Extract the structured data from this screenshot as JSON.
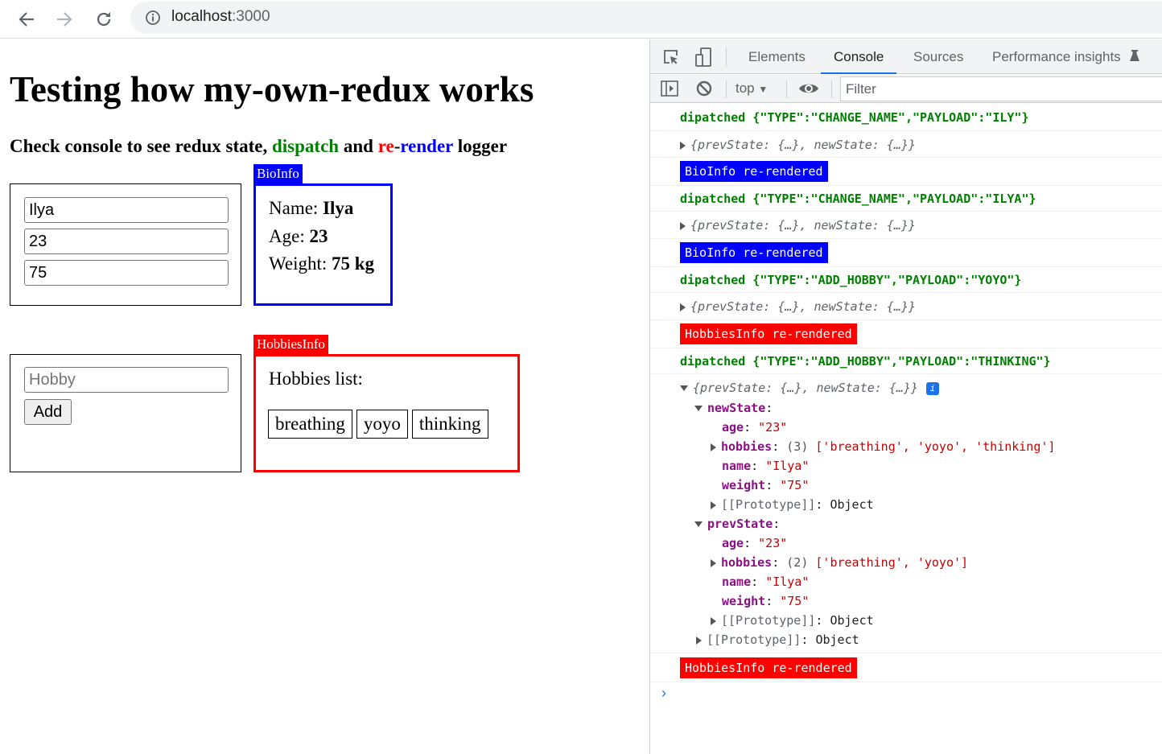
{
  "browser": {
    "url_host": "localhost",
    "url_port": ":3000",
    "back_icon": "arrow-left-icon",
    "forward_icon": "arrow-right-icon",
    "reload_icon": "reload-icon",
    "info_icon": "info-circle-icon"
  },
  "page": {
    "title": "Testing how my-own-redux works",
    "subtitle": {
      "part1": "Check console to see redux state, ",
      "dispatch": "dispatch",
      "part2": " and ",
      "re": "re",
      "dash": "-",
      "render": "render",
      "part3": " logger"
    },
    "bio_form": {
      "name_value": "Ilya",
      "age_value": "23",
      "weight_value": "75"
    },
    "bio_info": {
      "tag": "BioInfo",
      "name_label": "Name: ",
      "name_value": "Ilya",
      "age_label": "Age: ",
      "age_value": "23",
      "weight_label": "Weight: ",
      "weight_value": "75 kg",
      "color": "#0000ff"
    },
    "hobby_form": {
      "placeholder": "Hobby",
      "value": "",
      "add_label": "Add"
    },
    "hobbies_info": {
      "tag": "HobbiesInfo",
      "heading": "Hobbies list:",
      "items": [
        "breathing",
        "yoyo",
        "thinking"
      ],
      "color": "#ff0000"
    }
  },
  "devtools": {
    "tabs": [
      {
        "label": "Elements",
        "active": false
      },
      {
        "label": "Console",
        "active": true
      },
      {
        "label": "Sources",
        "active": false
      },
      {
        "label": "Performance insights",
        "active": false
      }
    ],
    "context": "top",
    "filter_placeholder": "Filter",
    "accent": "#1a73e8",
    "logs": [
      {
        "type": "dispatch",
        "text": "dipatched {\"TYPE\":\"CHANGE_NAME\",\"PAYLOAD\":\"ILY\"}"
      },
      {
        "type": "object",
        "text": "{prevState: {…}, newState: {…}}"
      },
      {
        "type": "badge",
        "text": "BioInfo re-rendered",
        "color": "#0000ff"
      },
      {
        "type": "dispatch",
        "text": "dipatched {\"TYPE\":\"CHANGE_NAME\",\"PAYLOAD\":\"ILYA\"}"
      },
      {
        "type": "object",
        "text": "{prevState: {…}, newState: {…}}"
      },
      {
        "type": "badge",
        "text": "BioInfo re-rendered",
        "color": "#0000ff"
      },
      {
        "type": "dispatch",
        "text": "dipatched {\"TYPE\":\"ADD_HOBBY\",\"PAYLOAD\":\"YOYO\"}"
      },
      {
        "type": "object",
        "text": "{prevState: {…}, newState: {…}}"
      },
      {
        "type": "badge",
        "text": "HobbiesInfo re-rendered",
        "color": "#ff0000"
      },
      {
        "type": "dispatch",
        "text": "dipatched {\"TYPE\":\"ADD_HOBBY\",\"PAYLOAD\":\"THINKING\"}"
      }
    ],
    "expanded": {
      "summary": "{prevState: {…}, newState: {…}}",
      "newState": {
        "label": "newState",
        "age_key": "age",
        "age": "\"23\"",
        "hobbies_key": "hobbies",
        "hobbies_count": "(3)",
        "hobbies": "['breathing', 'yoyo', 'thinking']",
        "name_key": "name",
        "name": "\"Ilya\"",
        "weight_key": "weight",
        "weight": "\"75\"",
        "proto_key": "[[Prototype]]",
        "proto_val": "Object"
      },
      "prevState": {
        "label": "prevState",
        "age_key": "age",
        "age": "\"23\"",
        "hobbies_key": "hobbies",
        "hobbies_count": "(2)",
        "hobbies": "['breathing', 'yoyo']",
        "name_key": "name",
        "name": "\"Ilya\"",
        "weight_key": "weight",
        "weight": "\"75\"",
        "proto_key": "[[Prototype]]",
        "proto_val": "Object"
      },
      "root_proto_key": "[[Prototype]]",
      "root_proto_val": "Object"
    },
    "final_log": {
      "text": "HobbiesInfo re-rendered",
      "color": "#ff0000"
    }
  }
}
